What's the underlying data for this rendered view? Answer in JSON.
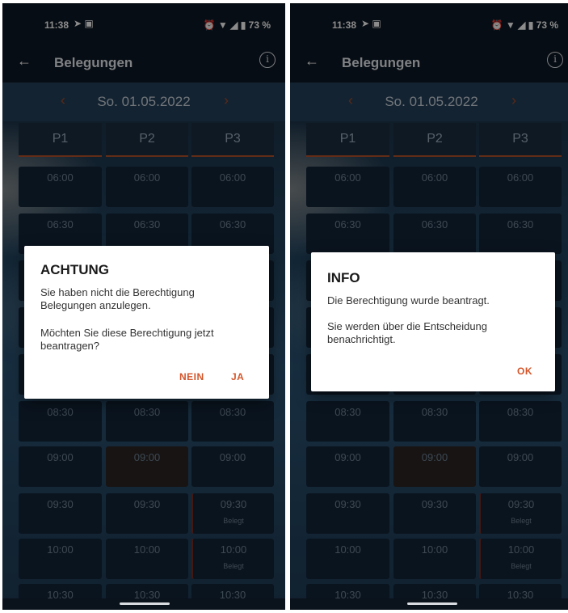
{
  "screens": [
    {
      "status": {
        "time": "11:38",
        "battery": "73 %"
      },
      "appbar": {
        "title": "Belegungen",
        "info_icon": "i"
      },
      "datebar": {
        "date": "So. 01.05.2022",
        "prev": "‹",
        "next": "›"
      },
      "columns": [
        "P1",
        "P2",
        "P3"
      ],
      "rows": [
        [
          "06:00",
          "06:00",
          "06:00"
        ],
        [
          "06:30",
          "06:30",
          "06:30"
        ],
        [
          "08:30",
          "08:30",
          "08:30"
        ],
        [
          "09:00",
          "09:00",
          "09:00"
        ],
        [
          "09:30",
          "09:30",
          "09:30"
        ],
        [
          "10:00",
          "10:00",
          "10:00"
        ],
        [
          "10:30",
          "10:30",
          "10:30"
        ]
      ],
      "booked_label": "Belegt",
      "dialog": {
        "title": "ACHTUNG",
        "message1": "Sie haben nicht die Berechtigung Belegungen anzulegen.",
        "message2": "Möchten Sie diese Berechtigung jetzt beantragen?",
        "btn_no": "NEIN",
        "btn_yes": "JA"
      }
    },
    {
      "status": {
        "time": "11:38",
        "battery": "73 %"
      },
      "appbar": {
        "title": "Belegungen",
        "info_icon": "i"
      },
      "datebar": {
        "date": "So. 01.05.2022",
        "prev": "‹",
        "next": "›"
      },
      "columns": [
        "P1",
        "P2",
        "P3"
      ],
      "rows": [
        [
          "06:00",
          "06:00",
          "06:00"
        ],
        [
          "06:30",
          "06:30",
          "06:30"
        ],
        [
          "08:30",
          "08:30",
          "08:30"
        ],
        [
          "09:00",
          "09:00",
          "09:00"
        ],
        [
          "09:30",
          "09:30",
          "09:30"
        ],
        [
          "10:00",
          "10:00",
          "10:00"
        ],
        [
          "10:30",
          "10:30",
          "10:30"
        ]
      ],
      "booked_label": "Belegt",
      "dialog": {
        "title": "INFO",
        "message1": "Die Berechtigung wurde beantragt.",
        "message2": "Sie werden über die Entscheidung benachrichtigt.",
        "btn_ok": "OK"
      }
    }
  ]
}
